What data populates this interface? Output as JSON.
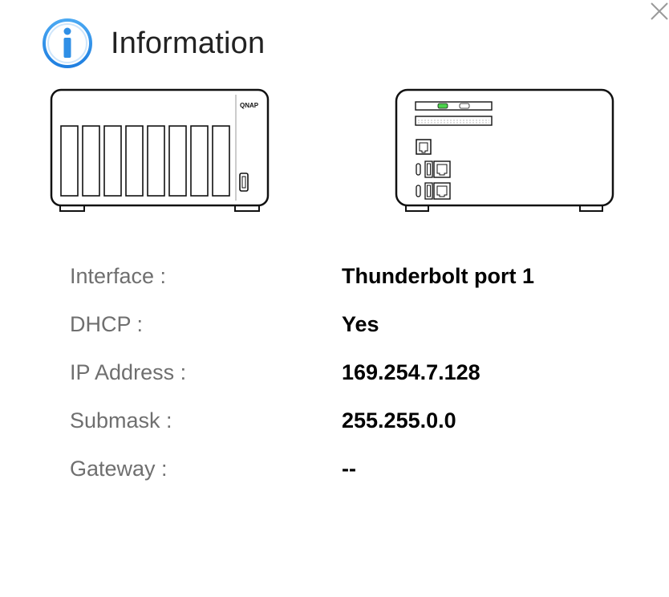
{
  "dialog": {
    "title": "Information",
    "close_icon": "close-icon",
    "title_icon": "info-icon"
  },
  "devices": {
    "front_brand": "QNAP",
    "front_icon": "nas-front-icon",
    "back_icon": "nas-rear-ports-icon"
  },
  "info": {
    "rows": [
      {
        "label": "Interface :",
        "value": "Thunderbolt port 1"
      },
      {
        "label": "DHCP :",
        "value": "Yes"
      },
      {
        "label": "IP Address :",
        "value": "169.254.7.128"
      },
      {
        "label": "Submask :",
        "value": "255.255.0.0"
      },
      {
        "label": "Gateway :",
        "value": "--"
      }
    ]
  },
  "colors": {
    "accent": "#2f8fe6",
    "label_text": "#6f6f6f",
    "value_text": "#000000",
    "status_led": "#4cd24c"
  }
}
